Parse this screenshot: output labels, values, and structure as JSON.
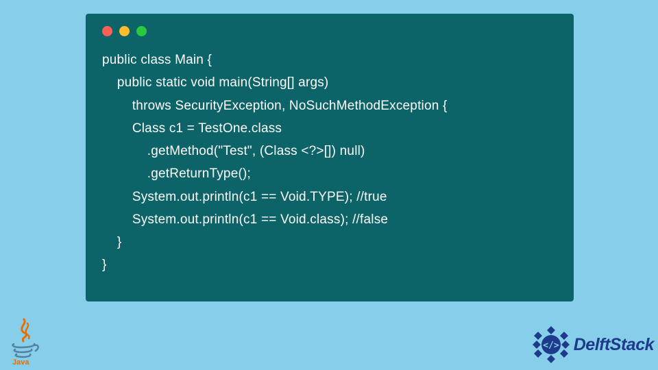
{
  "code": {
    "lines": [
      "public class Main {",
      "    public static void main(String[] args)",
      "        throws SecurityException, NoSuchMethodException {",
      "        Class c1 = TestOne.class",
      "            .getMethod(\"Test\", (Class <?>[]) null)",
      "            .getReturnType();",
      "        System.out.println(c1 == Void.TYPE); //true",
      "        System.out.println(c1 == Void.class); //false",
      "    }",
      "}"
    ]
  },
  "window_controls": {
    "red": "#ff5f56",
    "yellow": "#ffbd2e",
    "green": "#27c93f"
  },
  "logos": {
    "java_label": "Java",
    "delft_label": "DelftStack"
  }
}
